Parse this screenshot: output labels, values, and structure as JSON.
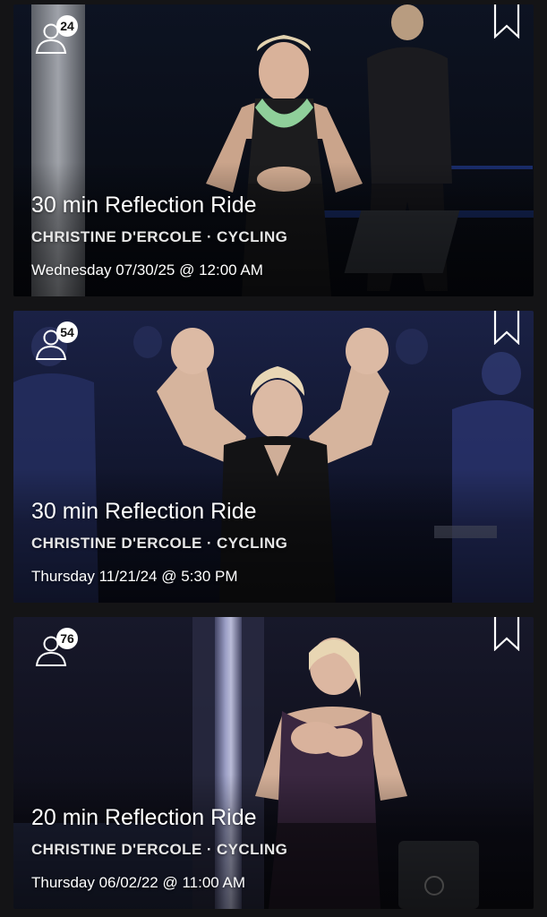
{
  "classes": [
    {
      "attendee_count": "24",
      "title": "30 min Reflection Ride",
      "instructor_discipline": "CHRISTINE D'ERCOLE · CYCLING",
      "air_date": "Wednesday 07/30/25 @ 12:00 AM",
      "bookmark_icon": "bookmark-icon",
      "attendee_icon": "person-icon"
    },
    {
      "attendee_count": "54",
      "title": "30 min Reflection Ride",
      "instructor_discipline": "CHRISTINE D'ERCOLE · CYCLING",
      "air_date": "Thursday 11/21/24 @ 5:30 PM",
      "bookmark_icon": "bookmark-icon",
      "attendee_icon": "person-icon"
    },
    {
      "attendee_count": "76",
      "title": "20 min Reflection Ride",
      "instructor_discipline": "CHRISTINE D'ERCOLE · CYCLING",
      "air_date": "Thursday 06/02/22 @ 11:00 AM",
      "bookmark_icon": "bookmark-icon",
      "attendee_icon": "person-icon"
    }
  ],
  "colors": {
    "background": "#141416",
    "text_primary": "#ffffff",
    "text_secondary": "#e6e6e6",
    "badge_bg": "#ffffff"
  }
}
